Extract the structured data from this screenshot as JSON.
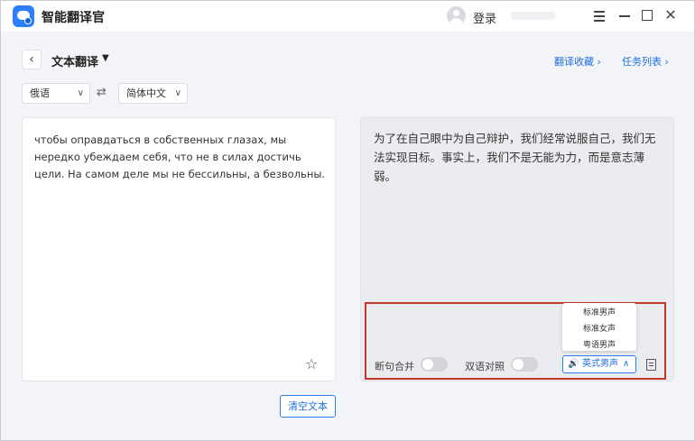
{
  "app": {
    "title": "智能翻译官"
  },
  "account": {
    "login_label": "登录"
  },
  "header": {
    "back_symbol": "‹",
    "page_title": "文本翻译",
    "title_caret": "▼",
    "links": {
      "favorites": "翻译收藏 ›",
      "tasks": "任务列表 ›"
    }
  },
  "languages": {
    "source": "俄语",
    "target": "简体中文",
    "swap_symbol": "⇄",
    "chevron": "∨"
  },
  "source_panel": {
    "text": "чтобы оправдаться в собственных глазах, мы нередко убеждаем себя, что не в силах достичь цели. На самом деле мы не бессильны, а безвольны.",
    "star_symbol": "☆"
  },
  "output_panel": {
    "text": "为了在自己眼中为自己辩护，我们经常说服自己，我们无法实现目标。事实上，我们不是无能为力，而是意志薄弱。"
  },
  "controls": {
    "merge_label": "断句合并",
    "bilingual_label": "双语对照",
    "voice_selected": "英式男声",
    "voice_options": [
      "标准男声",
      "标准女声",
      "粤语男声"
    ],
    "speaker_symbol": "🔊",
    "caret_up": "∧"
  },
  "actions": {
    "clear_label": "清空文本"
  },
  "colors": {
    "accent": "#1f6fe5",
    "highlight_border": "#c0392b",
    "logo": "#2d7ff9"
  },
  "icons": [
    "app-logo-icon",
    "avatar-icon",
    "menu-icon",
    "minimize-icon",
    "maximize-icon",
    "close-icon",
    "back-icon",
    "swap-icon",
    "star-icon",
    "speaker-icon",
    "copy-icon"
  ]
}
